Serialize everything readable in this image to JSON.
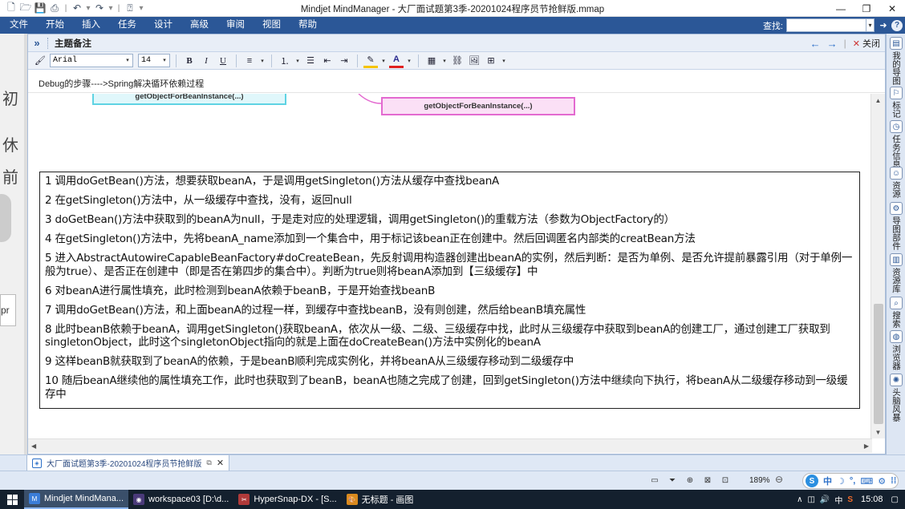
{
  "window": {
    "title": "Mindjet MindManager - 大厂面试题第3季-20201024程序员节抢鲜版.mmap",
    "controls": [
      "minimize",
      "restore",
      "close"
    ]
  },
  "menu": {
    "items": [
      "文件",
      "开始",
      "插入",
      "任务",
      "设计",
      "高级",
      "审阅",
      "视图",
      "帮助"
    ],
    "search_label": "查找:",
    "search_value": ""
  },
  "left_strip": {
    "chars": [
      "初",
      "休",
      "前"
    ],
    "box_text": "pr"
  },
  "notes_panel": {
    "title": "主题备注",
    "close_label": "关闭",
    "font_name": "Arial",
    "font_size": "14",
    "subject": "Debug的步骤---->Spring解决循环依赖过程",
    "node_left": "getObjectForBeanInstance(...)",
    "node_right": "getObjectForBeanInstance(...)",
    "lines": [
      "1 调用doGetBean()方法，想要获取beanA，于是调用getSingleton()方法从缓存中查找beanA",
      "2 在getSingleton()方法中，从一级缓存中查找，没有，返回null",
      "3 doGetBean()方法中获取到的beanA为null，于是走对应的处理逻辑，调用getSingleton()的重载方法（参数为ObjectFactory的）",
      "4 在getSingleton()方法中，先将beanA_name添加到一个集合中，用于标记该bean正在创建中。然后回调匿名内部类的creatBean方法",
      "5 进入AbstractAutowireCapableBeanFactory#doCreateBean，先反射调用构造器创建出beanA的实例，然后判断：是否为单例、是否允许提前暴露引用（对于单例一般为true）、是否正在创建中（即是否在第四步的集合中）。判断为true则将beanA添加到【三级缓存】中",
      "6 对beanA进行属性填充，此时检测到beanA依赖于beanB，于是开始查找beanB",
      "7 调用doGetBean()方法，和上面beanA的过程一样，到缓存中查找beanB，没有则创建，然后给beanB填充属性",
      "8 此时beanB依赖于beanA，调用getSingleton()获取beanA，依次从一级、二级、三级缓存中找，此时从三级缓存中获取到beanA的创建工厂，通过创建工厂获取到singletonObject，此时这个singletonObject指向的就是上面在doCreateBean()方法中实例化的beanA",
      "9 这样beanB就获取到了beanA的依赖，于是beanB顺利完成实例化，并将beanA从三级缓存移动到二级缓存中",
      "10 随后beanA继续他的属性填充工作，此时也获取到了beanB，beanA也随之完成了创建，回到getSingleton()方法中继续向下执行，将beanA从二级缓存移动到一级缓存中"
    ]
  },
  "sidebar_tabs": [
    "我的导图",
    "标记",
    "任务信息",
    "资源",
    "导图部件",
    "资源库",
    "搜索",
    "浏览器",
    "头脑风暴"
  ],
  "doc_tab": {
    "label": "大厂面试题第3季-20201024程序员节抢鲜版"
  },
  "status": {
    "zoom": "189%",
    "ime_label": "中"
  },
  "taskbar": {
    "tasks": [
      {
        "label": "Mindjet MindMana...",
        "icon": "mindmanager-icon",
        "active": true
      },
      {
        "label": "workspace03 [D:\\d...",
        "icon": "eclipse-icon",
        "active": false
      },
      {
        "label": "HyperSnap-DX - [S...",
        "icon": "hypersnap-icon",
        "active": false
      },
      {
        "label": "无标题 - 画图",
        "icon": "paint-icon",
        "active": false
      }
    ],
    "tray_ime": "中",
    "time": "15:08"
  },
  "colors": {
    "menubar_bg": "#2b5797",
    "node_cyan_border": "#5fd3e3",
    "node_pink_border": "#e36ad0",
    "taskbar_bg": "#14202e"
  }
}
